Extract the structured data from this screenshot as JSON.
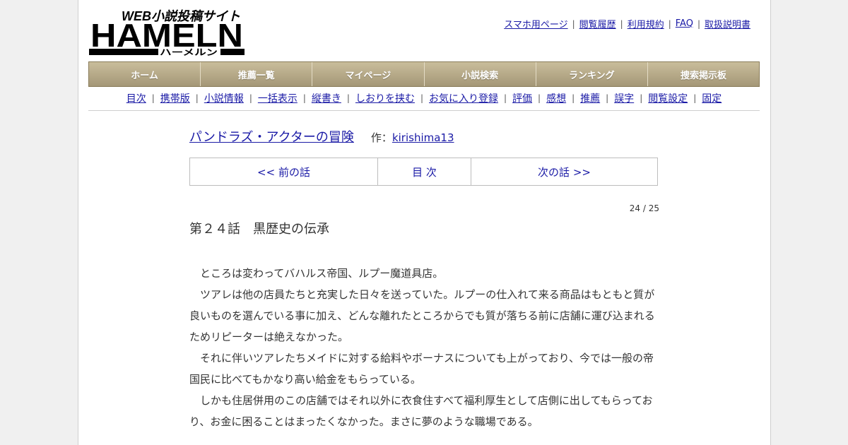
{
  "header": {
    "logo_subtitle": "WEB小説投稿サイト",
    "logo_main": "HAMELN",
    "logo_kana": "ハーメルン",
    "top_links": [
      "スマホ用ページ",
      "閲覧履歴",
      "利用規約",
      "FAQ",
      "取扱説明書"
    ]
  },
  "main_nav": [
    "ホーム",
    "推薦一覧",
    "マイページ",
    "小説検索",
    "ランキング",
    "捜索掲示板"
  ],
  "sub_nav": [
    "目次",
    "携帯版",
    "小説情報",
    "一括表示",
    "縦書き",
    "しおりを挟む",
    "お気に入り登録",
    "評価",
    "感想",
    "推薦",
    "誤字",
    "閲覧設定",
    "固定"
  ],
  "novel": {
    "title": "パンドラズ・アクターの冒険",
    "author_prefix": "作：",
    "author": "kirishima13"
  },
  "pager": {
    "prev": "<< 前の話",
    "toc": "目 次",
    "next": "次の話 >>"
  },
  "counter": "24 / 25",
  "chapter_title": "第２４話　黒歴史の伝承",
  "paragraphs": [
    "　ところは変わってバハルス帝国、ルプー魔道具店。",
    "　ツアレは他の店員たちと充実した日々を送っていた。ルプーの仕入れて来る商品はもともと質が良いものを選んでいる事に加え、どんな離れたところからでも質が落ちる前に店舗に運び込まれるためリピーターは絶えなかった。",
    "　それに伴いツアレたちメイドに対する給料やボーナスについても上がっており、今では一般の帝国民に比べてもかなり高い給金をもらっている。",
    "　しかも住居併用のこの店舗ではそれ以外に衣食住すべて福利厚生として店側に出してもらっており、お金に困ることはまったくなかった。まさに夢のような職場である。"
  ],
  "colors": {
    "nav_bar": "#a49777",
    "link": "#1a1aa6",
    "page_bg": "#ffffff",
    "outer_bg": "#f0f0f0"
  }
}
